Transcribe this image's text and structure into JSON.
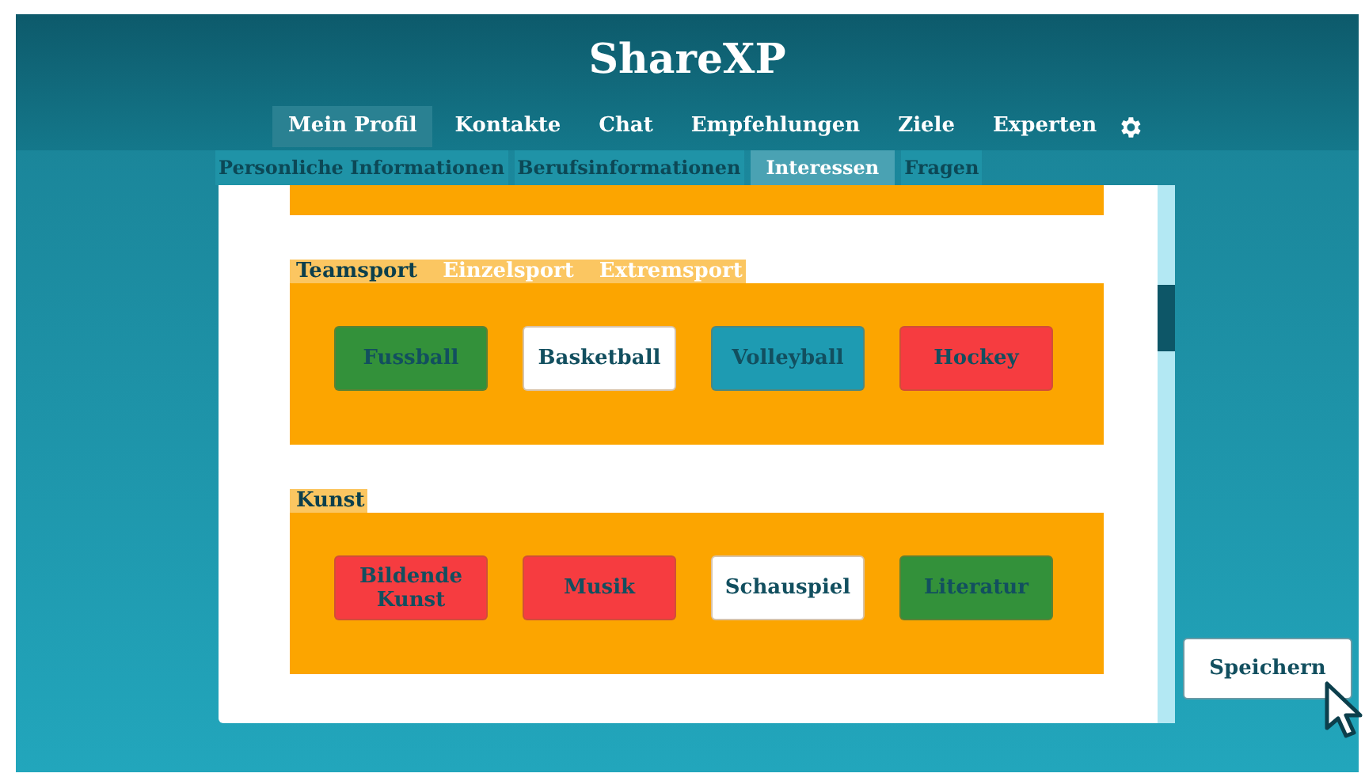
{
  "header": {
    "title": "ShareXP"
  },
  "nav": [
    {
      "label": "Mein Profil",
      "selected": true
    },
    {
      "label": "Kontakte",
      "selected": false
    },
    {
      "label": "Chat",
      "selected": false
    },
    {
      "label": "Empfehlungen",
      "selected": false
    },
    {
      "label": "Ziele",
      "selected": false
    },
    {
      "label": "Experten",
      "selected": false
    }
  ],
  "subtabs": [
    {
      "label": "Personliche Informationen",
      "selected": false
    },
    {
      "label": "Berufsinformationen",
      "selected": false
    },
    {
      "label": "Interessen",
      "selected": true
    },
    {
      "label": "Fragen",
      "selected": false
    }
  ],
  "sections": [
    {
      "tabs": [
        {
          "label": "Teamsport",
          "selected": true
        },
        {
          "label": "Einzelsport",
          "selected": false
        },
        {
          "label": "Extremsport",
          "selected": false
        }
      ],
      "items": [
        {
          "label": "Fussball",
          "color": "#33913a"
        },
        {
          "label": "Basketball",
          "color": "#ffffff"
        },
        {
          "label": "Volleyball",
          "color": "#1e9bb2"
        },
        {
          "label": "Hockey",
          "color": "#f63c40"
        }
      ]
    },
    {
      "tabs": [
        {
          "label": "Kunst",
          "selected": true
        }
      ],
      "items": [
        {
          "label": "Bildende Kunst",
          "color": "#f63c40"
        },
        {
          "label": "Musik",
          "color": "#f63c40"
        },
        {
          "label": "Schauspiel",
          "color": "#ffffff"
        },
        {
          "label": "Literatur",
          "color": "#33913a"
        }
      ]
    }
  ],
  "save_button": "Speichern"
}
